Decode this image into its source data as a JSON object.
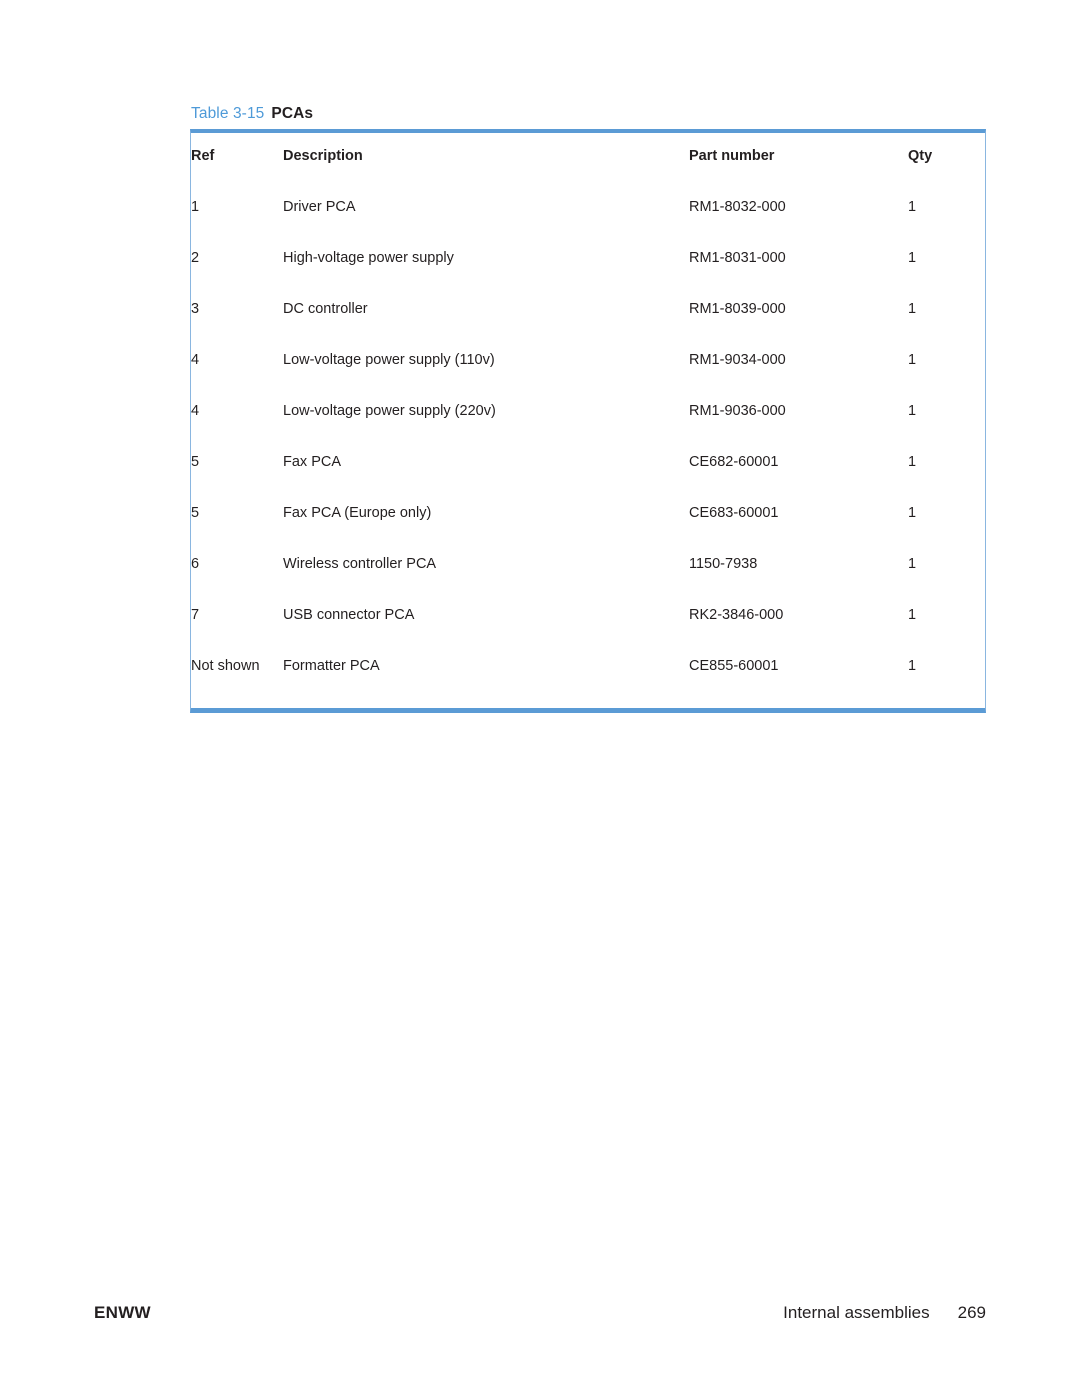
{
  "table": {
    "caption_label": "Table 3-15",
    "caption_title": "PCAs",
    "accent_color": "#5b9bd5",
    "caption_color": "#4e9ad8",
    "columns": [
      "Ref",
      "Description",
      "Part number",
      "Qty"
    ],
    "rows": [
      {
        "ref": "1",
        "description": "Driver PCA",
        "part_number": "RM1-8032-000",
        "qty": "1"
      },
      {
        "ref": "2",
        "description": "High-voltage power supply",
        "part_number": "RM1-8031-000",
        "qty": "1"
      },
      {
        "ref": "3",
        "description": "DC controller",
        "part_number": "RM1-8039-000",
        "qty": "1"
      },
      {
        "ref": "4",
        "description": "Low-voltage power supply (110v)",
        "part_number": "RM1-9034-000",
        "qty": "1"
      },
      {
        "ref": "4",
        "description": "Low-voltage power supply (220v)",
        "part_number": "RM1-9036-000",
        "qty": "1"
      },
      {
        "ref": "5",
        "description": "Fax PCA",
        "part_number": "CE682-60001",
        "qty": "1"
      },
      {
        "ref": "5",
        "description": "Fax PCA (Europe only)",
        "part_number": "CE683-60001",
        "qty": "1"
      },
      {
        "ref": "6",
        "description": "Wireless controller PCA",
        "part_number": "1150-7938",
        "qty": "1"
      },
      {
        "ref": "7",
        "description": "USB connector PCA",
        "part_number": "RK2-3846-000",
        "qty": "1"
      },
      {
        "ref": "Not shown",
        "description": "Formatter PCA",
        "part_number": "CE855-60001",
        "qty": "1"
      }
    ]
  },
  "footer": {
    "left": "ENWW",
    "chapter": "Internal assemblies",
    "page_number": "269"
  }
}
